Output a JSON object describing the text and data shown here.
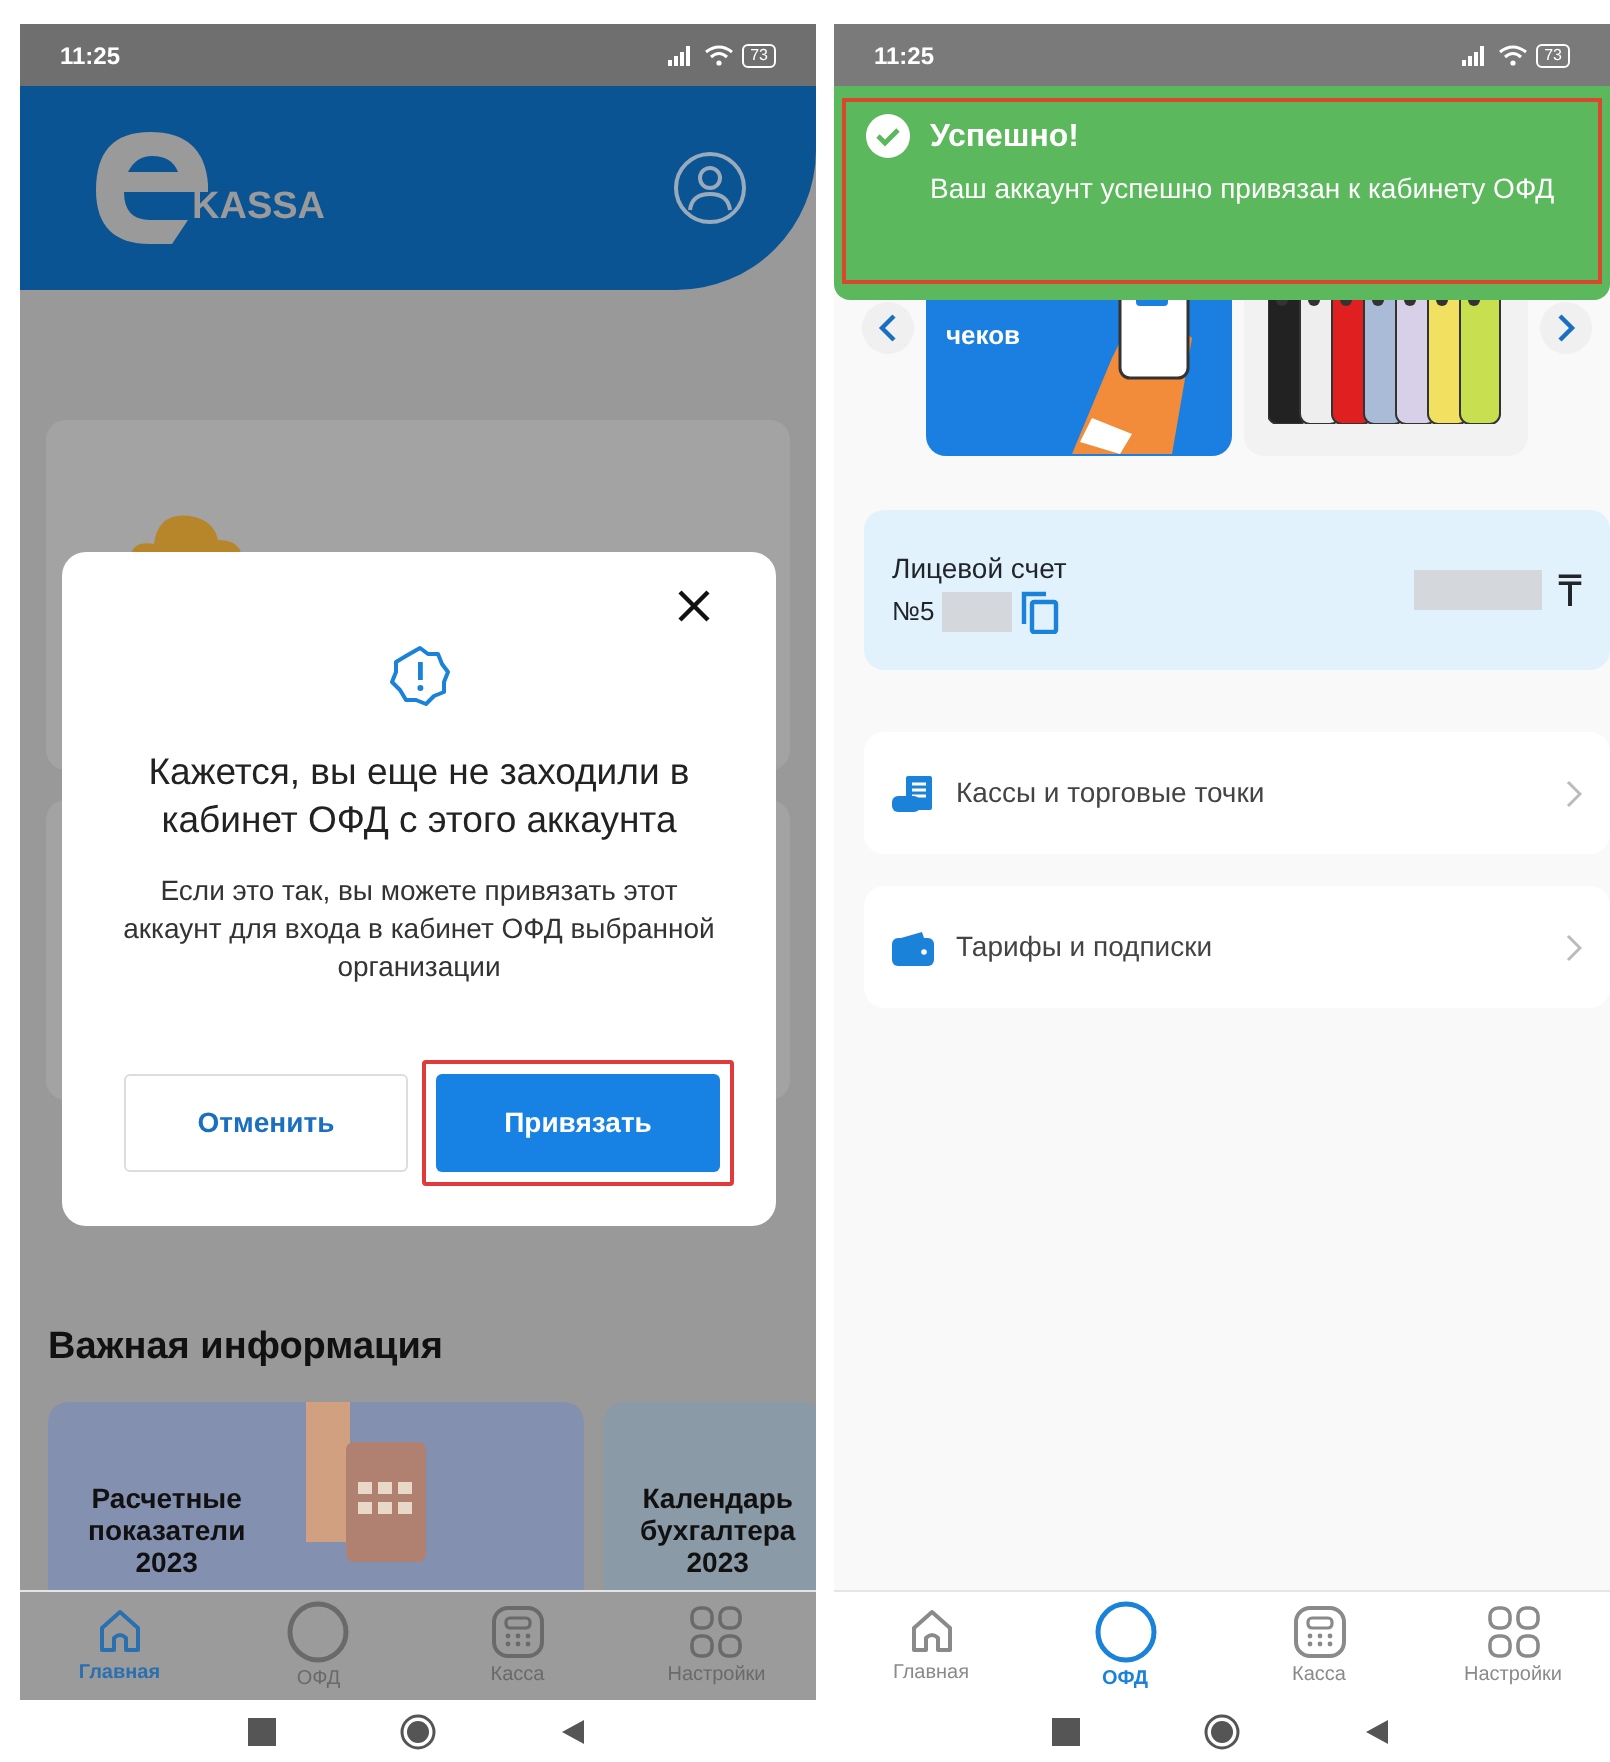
{
  "screens": [
    {
      "status_bar": {
        "time": "11:25",
        "battery": "73"
      },
      "header": {
        "logo_text": "KASSA"
      },
      "section_title": "Важная информация",
      "info_cards": [
        {
          "title": "Расчетные\nпоказатели\n2023",
          "kind": "indicators"
        },
        {
          "title": "Календарь\nбухгалтера\n2023",
          "kind": "calendar"
        }
      ],
      "dialog": {
        "title": "Кажется, вы еще не заходили в кабинет ОФД с этого аккаунта",
        "message": "Если это так, вы можете привязать этот аккаунт для входа в кабинет ОФД выбранной организации",
        "buttons": [
          {
            "label": "Отменить",
            "kind": "secondary",
            "highlighted": false
          },
          {
            "label": "Привязать",
            "kind": "primary",
            "highlighted": true
          }
        ]
      },
      "nav": [
        {
          "label": "Главная",
          "selected": true
        },
        {
          "label": "ОФД",
          "selected": false
        },
        {
          "label": "Касса",
          "selected": false
        },
        {
          "label": "Настройки",
          "selected": false
        }
      ]
    },
    {
      "status_bar": {
        "time": "11:25",
        "battery": "73"
      },
      "toast": {
        "title": "Успешно!",
        "message": "Ваш аккаунт успешно привязан к кабинету ОФД",
        "highlighted": true
      },
      "banners": [
        {
          "kind": "hand",
          "text": "чеков"
        },
        {
          "kind": "phones"
        }
      ],
      "account": {
        "label": "Лицевой счет",
        "number": "№5",
        "currency": "₸"
      },
      "menu": [
        {
          "label": "Кассы и торговые точки"
        },
        {
          "label": "Тарифы и подписки"
        }
      ],
      "nav": [
        {
          "label": "Главная",
          "selected": false
        },
        {
          "label": "ОФД",
          "selected": true
        },
        {
          "label": "Касса",
          "selected": false
        },
        {
          "label": "Настройки",
          "selected": false
        }
      ]
    }
  ]
}
